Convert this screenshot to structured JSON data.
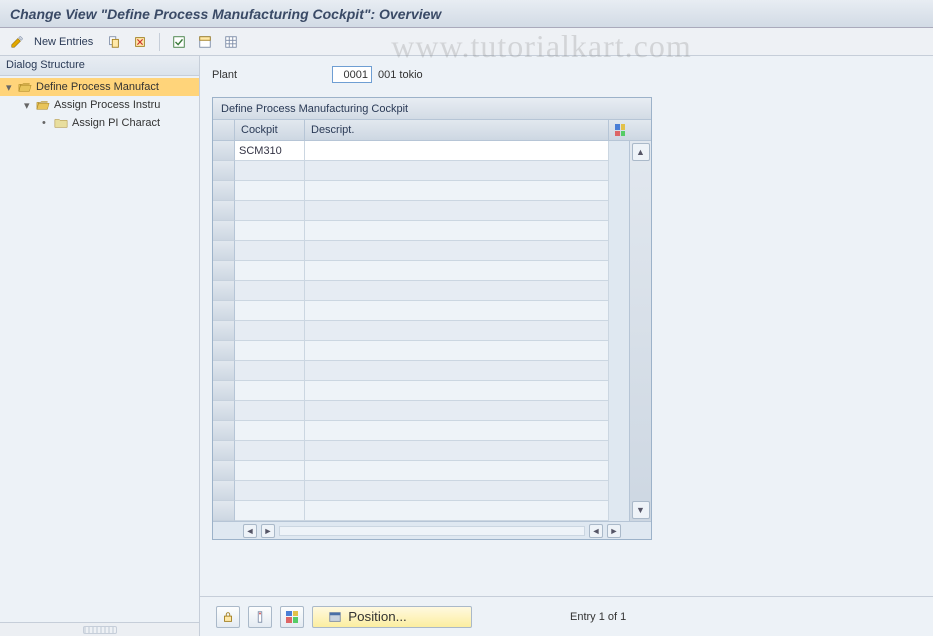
{
  "title": "Change View \"Define Process Manufacturing Cockpit\": Overview",
  "watermark": "www.tutorialkart.com",
  "toolbar": {
    "new_entries_label": "New Entries"
  },
  "dialog_structure": {
    "header": "Dialog Structure",
    "nodes": [
      {
        "label": "Define Process Manufact",
        "level": 0,
        "open": true,
        "selected": true
      },
      {
        "label": "Assign Process Instru",
        "level": 1,
        "open": true,
        "selected": false
      },
      {
        "label": "Assign PI Charact",
        "level": 2,
        "open": false,
        "selected": false
      }
    ]
  },
  "plant": {
    "label": "Plant",
    "code": "0001",
    "description": "001 tokio"
  },
  "table": {
    "title": "Define Process Manufacturing Cockpit",
    "columns": {
      "cockpit": "Cockpit",
      "descript": "Descript."
    },
    "rows": [
      {
        "cockpit": "SCM310",
        "descript": ""
      }
    ],
    "blank_row_count": 18
  },
  "footer": {
    "position_label": "Position...",
    "entry_status": "Entry 1 of 1"
  }
}
